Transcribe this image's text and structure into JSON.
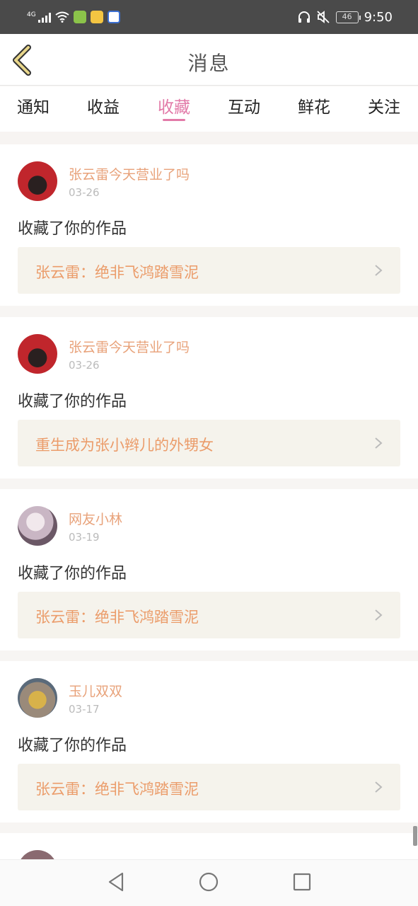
{
  "status_bar": {
    "network_label": "4G",
    "battery_level": "46",
    "time": "9:50",
    "icons": [
      "signal-icon",
      "wifi-icon",
      "app-notification-icon",
      "app-notification-icon",
      "app-notification-icon",
      "headphones-icon",
      "mute-icon",
      "battery-icon"
    ]
  },
  "header": {
    "title": "消息",
    "back_icon": "chevron-left-icon"
  },
  "tabs": [
    {
      "label": "通知",
      "active": false
    },
    {
      "label": "收益",
      "active": false
    },
    {
      "label": "收藏",
      "active": true
    },
    {
      "label": "互动",
      "active": false
    },
    {
      "label": "鲜花",
      "active": false
    },
    {
      "label": "关注",
      "active": false
    }
  ],
  "messages": [
    {
      "user": "张云雷今天营业了吗",
      "date": "03-26",
      "action": "收藏了你的作品",
      "work": "张云雷：绝非飞鸿踏雪泥"
    },
    {
      "user": "张云雷今天营业了吗",
      "date": "03-26",
      "action": "收藏了你的作品",
      "work": "重生成为张小辫儿的外甥女"
    },
    {
      "user": "网友小林",
      "date": "03-19",
      "action": "收藏了你的作品",
      "work": "张云雷：绝非飞鸿踏雪泥"
    },
    {
      "user": "玉儿双双",
      "date": "03-17",
      "action": "收藏了你的作品",
      "work": "张云雷：绝非飞鸿踏雪泥"
    }
  ],
  "colors": {
    "accent": "#e27aa8",
    "username": "#e8a27a",
    "work_title": "#eb9c6a",
    "work_bg": "#f5f3ec",
    "status_bar": "#4a4a4a"
  },
  "navbar": {
    "icons": [
      "back-triangle-icon",
      "home-circle-icon",
      "recents-square-icon"
    ]
  }
}
